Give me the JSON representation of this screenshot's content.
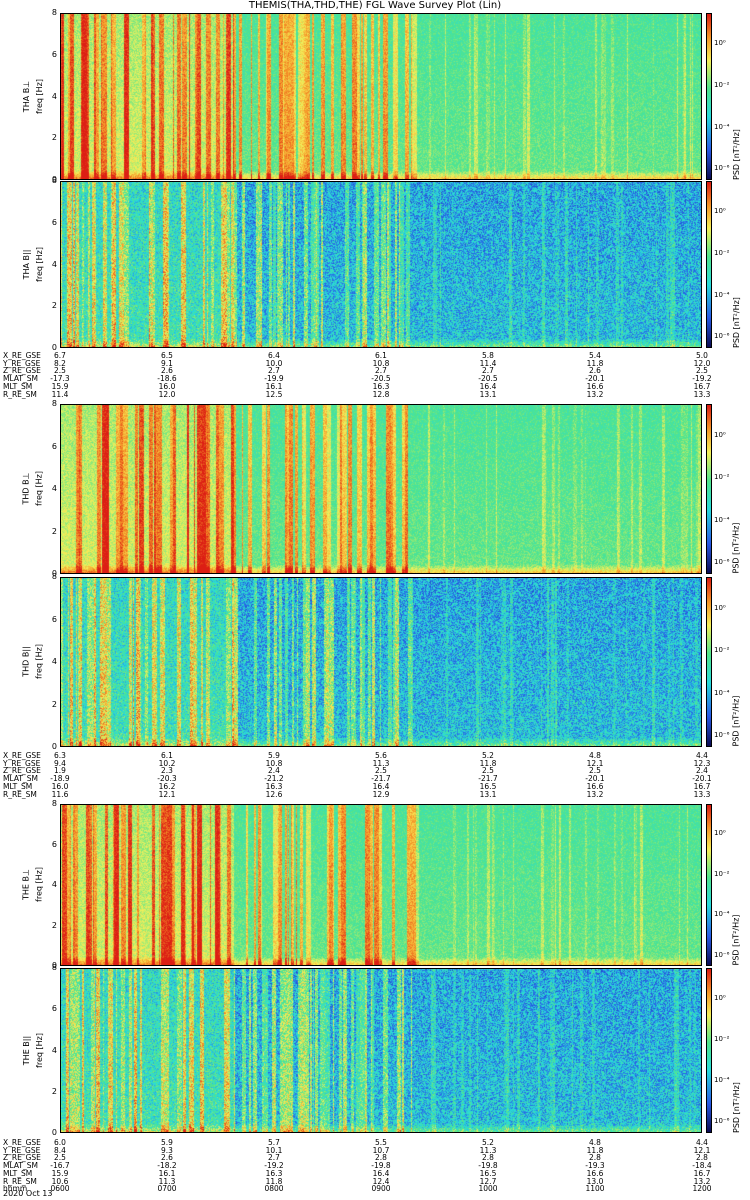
{
  "title": "THEMIS(THA,THD,THE) FGL Wave Survey Plot (Lin)",
  "colors": {
    "yellow": "#f7f05a",
    "green": "#4fe38a",
    "cyan": "#33e0d8",
    "blue": "#2a6fe0",
    "red": "#e0331f"
  },
  "chart_data": [
    {
      "type": "heatmap",
      "title": "",
      "probe": "THA",
      "panels": [
        {
          "ylabel": "THA B⊥",
          "yunits": "freq [Hz]",
          "yticks": [
            "0",
            "2",
            "4",
            "6",
            "8"
          ],
          "ylim": [
            0,
            8
          ],
          "cbar_label": "PSD [nT²/Hz]",
          "cbar_ticks": [
            "10⁰",
            "10⁻²",
            "10⁻⁴",
            "10⁻⁶"
          ],
          "level": "high"
        },
        {
          "ylabel": "THA B||",
          "yunits": "freq [Hz]",
          "yticks": [
            "0",
            "2",
            "4",
            "6",
            "8"
          ],
          "ylim": [
            0,
            8
          ],
          "cbar_label": "PSD [nT²/Hz]",
          "cbar_ticks": [
            "10⁰",
            "10⁻²",
            "10⁻⁴",
            "10⁻⁶"
          ],
          "level": "low"
        }
      ],
      "ephemeris": {
        "labels": [
          "X_RE_GSE",
          "Y_RE_GSE",
          "Z_RE_GSE",
          "MLAT_SM",
          "MLT_SM",
          "R_RE_SM"
        ],
        "columns": [
          [
            "6.7",
            "8.2",
            "2.5",
            "-17.3",
            "15.9",
            "11.4"
          ],
          [
            "6.5",
            "9.1",
            "2.6",
            "-18.6",
            "16.0",
            "12.0"
          ],
          [
            "6.4",
            "10.0",
            "2.7",
            "-19.9",
            "16.1",
            "12.5"
          ],
          [
            "6.1",
            "10.8",
            "2.7",
            "-20.5",
            "16.3",
            "12.8"
          ],
          [
            "5.8",
            "11.4",
            "2.7",
            "-20.5",
            "16.4",
            "13.1"
          ],
          [
            "5.4",
            "11.8",
            "2.6",
            "-20.1",
            "16.6",
            "13.2"
          ],
          [
            "5.0",
            "12.0",
            "2.5",
            "-19.2",
            "16.7",
            "13.3"
          ]
        ]
      }
    },
    {
      "type": "heatmap",
      "title": "",
      "probe": "THD",
      "panels": [
        {
          "ylabel": "THD B⊥",
          "yunits": "freq [Hz]",
          "yticks": [
            "0",
            "2",
            "4",
            "6",
            "8"
          ],
          "ylim": [
            0,
            8
          ],
          "cbar_label": "PSD [nT²/Hz]",
          "cbar_ticks": [
            "10⁰",
            "10⁻²",
            "10⁻⁴",
            "10⁻⁶"
          ],
          "level": "high"
        },
        {
          "ylabel": "THD B||",
          "yunits": "freq [Hz]",
          "yticks": [
            "0",
            "2",
            "4",
            "6",
            "8"
          ],
          "ylim": [
            0,
            8
          ],
          "cbar_label": "PSD [nT²/Hz]",
          "cbar_ticks": [
            "10⁰",
            "10⁻²",
            "10⁻⁴",
            "10⁻⁶"
          ],
          "level": "low"
        }
      ],
      "ephemeris": {
        "labels": [
          "X_RE_GSE",
          "Y_RE_GSE",
          "Z_RE_GSE",
          "MLAT_SM",
          "MLT_SM",
          "R_RE_SM"
        ],
        "columns": [
          [
            "6.3",
            "9.4",
            "1.9",
            "-18.9",
            "16.0",
            "11.6"
          ],
          [
            "6.1",
            "10.2",
            "2.3",
            "-20.3",
            "16.2",
            "12.1"
          ],
          [
            "5.9",
            "10.8",
            "2.4",
            "-21.2",
            "16.3",
            "12.6"
          ],
          [
            "5.6",
            "11.3",
            "2.5",
            "-21.7",
            "16.4",
            "12.9"
          ],
          [
            "5.2",
            "11.8",
            "2.5",
            "-21.7",
            "16.5",
            "13.1"
          ],
          [
            "4.8",
            "12.1",
            "2.5",
            "-20.1",
            "16.6",
            "13.2"
          ],
          [
            "4.4",
            "12.3",
            "2.4",
            "-20.1",
            "16.7",
            "13.3"
          ]
        ]
      }
    },
    {
      "type": "heatmap",
      "title": "",
      "probe": "THE",
      "panels": [
        {
          "ylabel": "THE B⊥",
          "yunits": "freq [Hz]",
          "yticks": [
            "0",
            "2",
            "4",
            "6",
            "8"
          ],
          "ylim": [
            0,
            8
          ],
          "cbar_label": "PSD [nT²/Hz]",
          "cbar_ticks": [
            "10⁰",
            "10⁻²",
            "10⁻⁴",
            "10⁻⁶"
          ],
          "level": "high"
        },
        {
          "ylabel": "THE B||",
          "yunits": "freq [Hz]",
          "yticks": [
            "0",
            "2",
            "4",
            "6",
            "8"
          ],
          "ylim": [
            0,
            8
          ],
          "cbar_label": "PSD [nT²/Hz]",
          "cbar_ticks": [
            "10⁰",
            "10⁻²",
            "10⁻⁴",
            "10⁻⁶"
          ],
          "level": "low"
        }
      ],
      "ephemeris": {
        "labels": [
          "X_RE_GSE",
          "Y_RE_GSE",
          "Z_RE_GSE",
          "MLAT_SM",
          "MLT_SM",
          "R_RE_SM",
          "hhmm"
        ],
        "columns": [
          [
            "6.0",
            "8.4",
            "2.5",
            "-16.7",
            "15.9",
            "10.6",
            "0600"
          ],
          [
            "5.9",
            "9.3",
            "2.6",
            "-18.2",
            "16.1",
            "11.3",
            "0700"
          ],
          [
            "5.7",
            "10.1",
            "2.7",
            "-19.2",
            "16.3",
            "11.8",
            "0800"
          ],
          [
            "5.5",
            "10.7",
            "2.8",
            "-19.8",
            "16.4",
            "12.4",
            "0900"
          ],
          [
            "5.2",
            "11.3",
            "2.8",
            "-19.8",
            "16.5",
            "12.7",
            "1000"
          ],
          [
            "4.8",
            "11.8",
            "2.8",
            "-19.3",
            "16.6",
            "13.0",
            "1100"
          ],
          [
            "4.4",
            "12.1",
            "2.8",
            "-18.4",
            "16.7",
            "13.2",
            "1200"
          ]
        ]
      }
    }
  ],
  "footer_date": "2020 Oct 13"
}
